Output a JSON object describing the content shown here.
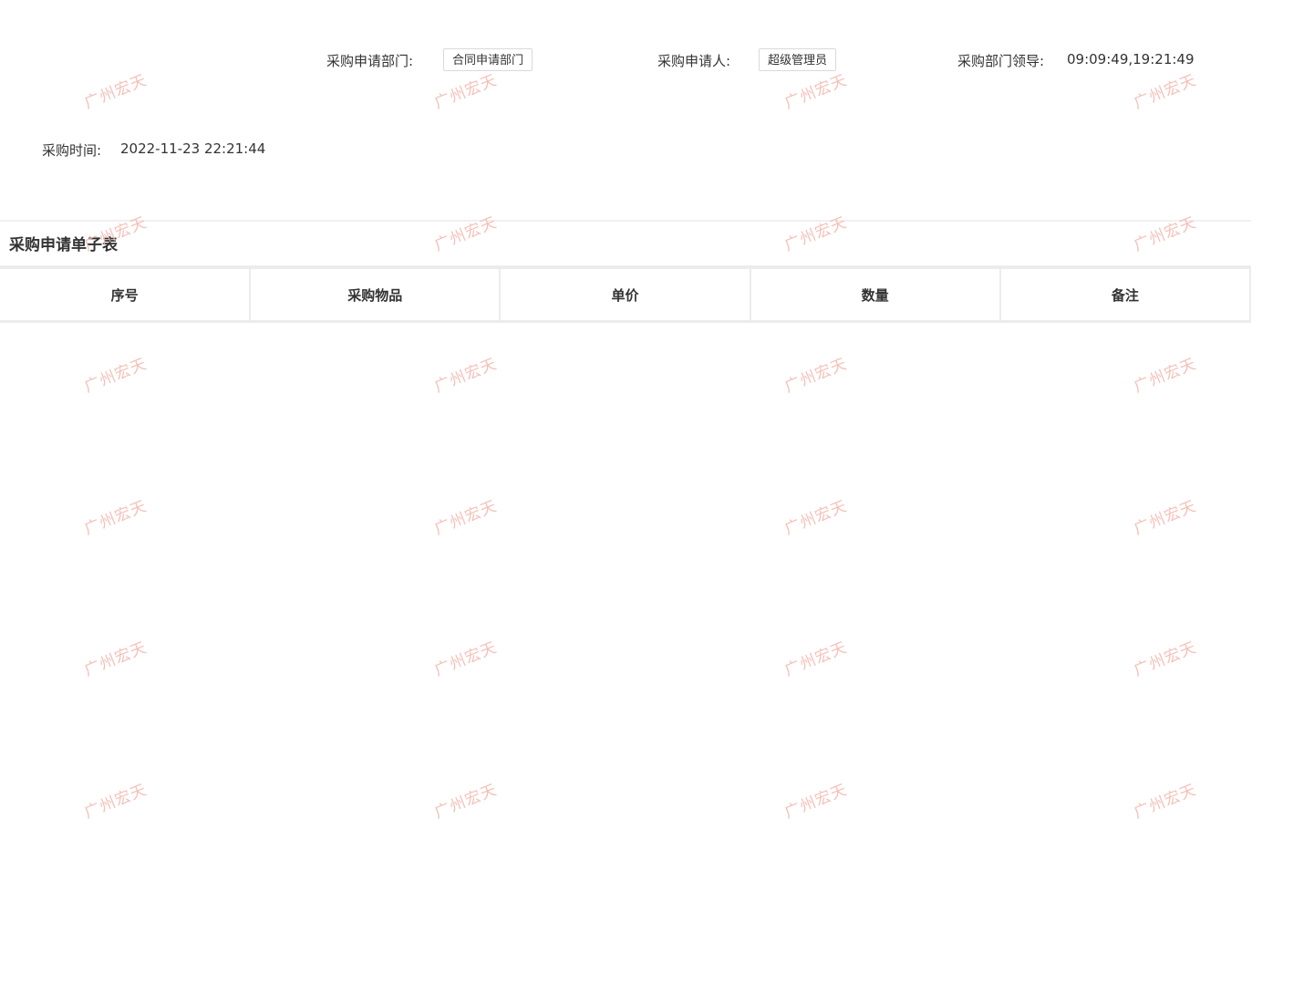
{
  "form": {
    "dept_label": "采购申请部门:",
    "dept_value": "合同申请部门",
    "applicant_label": "采购申请人:",
    "applicant_value": "超级管理员",
    "leader_label": "采购部门领导:",
    "leader_value": "09:09:49,19:21:49",
    "time_label": "采购时间:",
    "time_value": "2022-11-23 22:21:44"
  },
  "subtable": {
    "title": "采购申请单子表",
    "columns": [
      "序号",
      "采购物品",
      "单价",
      "数量",
      "备注"
    ],
    "rows": []
  },
  "watermark": {
    "text": "广州宏天",
    "color": "#f2b7ae"
  }
}
